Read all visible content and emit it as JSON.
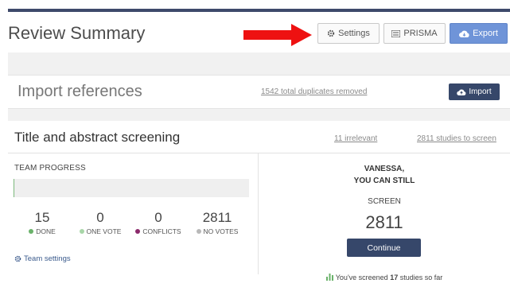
{
  "page": {
    "title": "Review Summary"
  },
  "toolbar": {
    "settings_label": "Settings",
    "prisma_label": "PRISMA",
    "export_label": "Export"
  },
  "import_section": {
    "title": "Import references",
    "duplicates_text": "1542 total duplicates removed",
    "import_label": "Import"
  },
  "screening": {
    "title": "Title and abstract screening",
    "irrelevant_link": "11 irrelevant",
    "to_screen_link": "2811 studies to screen",
    "team_progress_label": "TEAM PROGRESS",
    "progress_fraction": 0.005,
    "stats": [
      {
        "value": "15",
        "label": "DONE",
        "color": "#6ab26a"
      },
      {
        "value": "0",
        "label": "ONE VOTE",
        "color": "#a8d6a8"
      },
      {
        "value": "0",
        "label": "CONFLICTS",
        "color": "#8b2a6b"
      },
      {
        "value": "2811",
        "label": "NO VOTES",
        "color": "#b8b8b8"
      }
    ],
    "team_settings_label": "Team settings",
    "greeting_line1": "VANESSA,",
    "greeting_line2": "YOU CAN STILL",
    "screen_label": "SCREEN",
    "screen_count": "2811",
    "continue_label": "Continue",
    "screened_prefix": "You've screened ",
    "screened_count": "17",
    "screened_suffix": " studies so far"
  },
  "annotation": {
    "arrow_color": "#ee1111"
  },
  "colors": {
    "accent": "#6f94d8",
    "dark_button": "#36476a",
    "top_bar": "#3e4a6b"
  }
}
